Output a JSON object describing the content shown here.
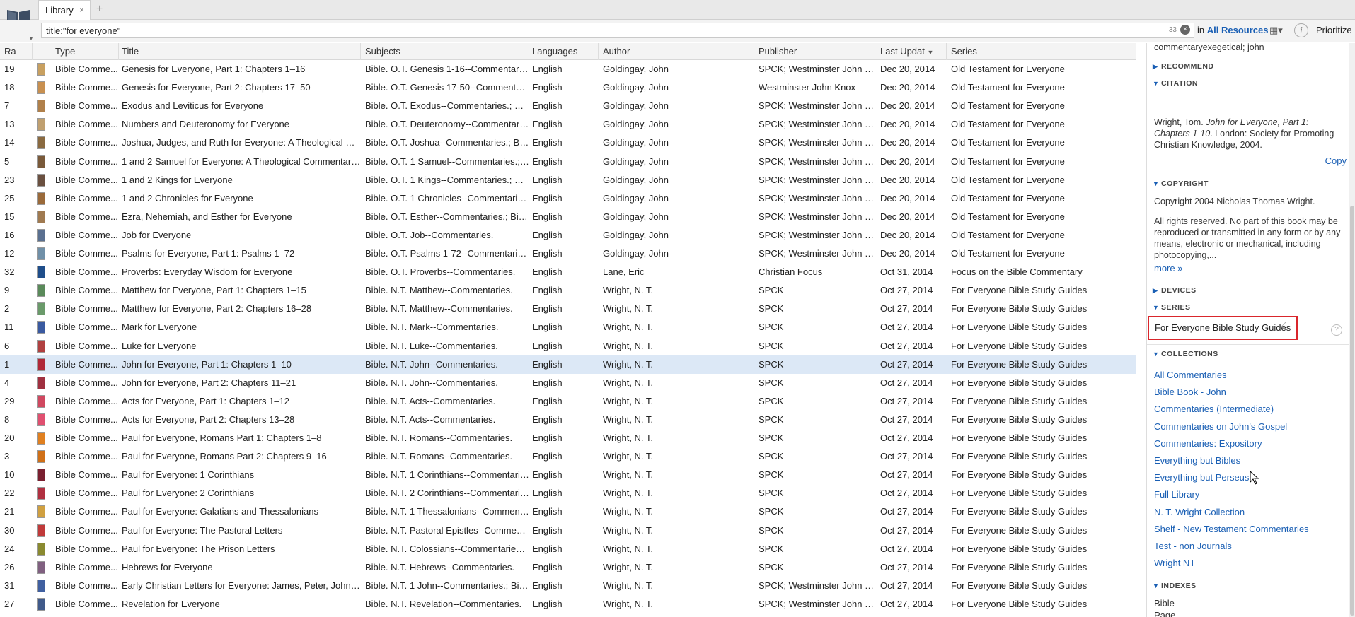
{
  "app": {
    "tab_label": "Library",
    "tab_close": "×",
    "new_tab": "+"
  },
  "search": {
    "query": "title:\"for everyone\"",
    "count": "33",
    "clear": "×",
    "in_label": "in",
    "resources": "All Resources",
    "prioritize": "Prioritize",
    "info": "i"
  },
  "columns": [
    "Ra",
    "Type",
    "Title",
    "Subjects",
    "Languages",
    "Author",
    "Publisher",
    "Last Updat",
    "Series"
  ],
  "rows": [
    {
      "rank": "19",
      "type": "Bible Comme...",
      "title": "Genesis for Everyone, Part 1: Chapters 1–16",
      "subjects": "Bible. O.T. Genesis 1-16--Commentaries.",
      "lang": "English",
      "author": "Goldingay, John",
      "publisher": "SPCK; Westminster John Knox",
      "date": "Dec 20, 2014",
      "series": "Old Testament for Everyone",
      "cover": "#c8a060"
    },
    {
      "rank": "18",
      "type": "Bible Comme...",
      "title": "Genesis for Everyone, Part 2: Chapters 17–50",
      "subjects": "Bible. O.T. Genesis 17-50--Commentaries.",
      "lang": "English",
      "author": "Goldingay, John",
      "publisher": "Westminster John Knox",
      "date": "Dec 20, 2014",
      "series": "Old Testament for Everyone",
      "cover": "#c89050"
    },
    {
      "rank": "7",
      "type": "Bible Comme...",
      "title": "Exodus and Leviticus for Everyone",
      "subjects": "Bible. O.T. Exodus--Commentaries.; Bibl...",
      "lang": "English",
      "author": "Goldingay, John",
      "publisher": "SPCK; Westminster John Knox",
      "date": "Dec 20, 2014",
      "series": "Old Testament for Everyone",
      "cover": "#b0804a"
    },
    {
      "rank": "13",
      "type": "Bible Comme...",
      "title": "Numbers and Deuteronomy for Everyone",
      "subjects": "Bible. O.T. Deuteronomy--Commentaries...",
      "lang": "English",
      "author": "Goldingay, John",
      "publisher": "SPCK; Westminster John Knox",
      "date": "Dec 20, 2014",
      "series": "Old Testament for Everyone",
      "cover": "#c0a070"
    },
    {
      "rank": "14",
      "type": "Bible Comme...",
      "title": "Joshua, Judges, and Ruth for Everyone: A Theological Com...",
      "subjects": "Bible. O.T. Joshua--Commentaries.; Bibl...",
      "lang": "English",
      "author": "Goldingay, John",
      "publisher": "SPCK; Westminster John Knox",
      "date": "Dec 20, 2014",
      "series": "Old Testament for Everyone",
      "cover": "#8a6a40"
    },
    {
      "rank": "5",
      "type": "Bible Comme...",
      "title": "1 and 2 Samuel for Everyone: A Theological Commentary on...",
      "subjects": "Bible. O.T. 1 Samuel--Commentaries.; Bi...",
      "lang": "English",
      "author": "Goldingay, John",
      "publisher": "SPCK; Westminster John Knox",
      "date": "Dec 20, 2014",
      "series": "Old Testament for Everyone",
      "cover": "#7a5a3a"
    },
    {
      "rank": "23",
      "type": "Bible Comme...",
      "title": "1 and 2 Kings for Everyone",
      "subjects": "Bible. O.T. 1 Kings--Commentaries.; Bibl...",
      "lang": "English",
      "author": "Goldingay, John",
      "publisher": "SPCK; Westminster John Knox",
      "date": "Dec 20, 2014",
      "series": "Old Testament for Everyone",
      "cover": "#6a5040"
    },
    {
      "rank": "25",
      "type": "Bible Comme...",
      "title": "1 and 2 Chronicles for Everyone",
      "subjects": "Bible. O.T. 1 Chronicles--Commentaries.;...",
      "lang": "English",
      "author": "Goldingay, John",
      "publisher": "SPCK; Westminster John Knox",
      "date": "Dec 20, 2014",
      "series": "Old Testament for Everyone",
      "cover": "#9a6a3a"
    },
    {
      "rank": "15",
      "type": "Bible Comme...",
      "title": "Ezra, Nehemiah, and Esther for Everyone",
      "subjects": "Bible. O.T. Esther--Commentaries.; Bible....",
      "lang": "English",
      "author": "Goldingay, John",
      "publisher": "SPCK; Westminster John Knox",
      "date": "Dec 20, 2014",
      "series": "Old Testament for Everyone",
      "cover": "#a07a50"
    },
    {
      "rank": "16",
      "type": "Bible Comme...",
      "title": "Job for Everyone",
      "subjects": "Bible. O.T. Job--Commentaries.",
      "lang": "English",
      "author": "Goldingay, John",
      "publisher": "SPCK; Westminster John Knox",
      "date": "Dec 20, 2014",
      "series": "Old Testament for Everyone",
      "cover": "#5a7090"
    },
    {
      "rank": "12",
      "type": "Bible Comme...",
      "title": "Psalms for Everyone, Part 1: Psalms 1–72",
      "subjects": "Bible. O.T. Psalms 1-72--Commentaries.",
      "lang": "English",
      "author": "Goldingay, John",
      "publisher": "SPCK; Westminster John Knox",
      "date": "Dec 20, 2014",
      "series": "Old Testament for Everyone",
      "cover": "#7090a8"
    },
    {
      "rank": "32",
      "type": "Bible Comme...",
      "title": "Proverbs: Everyday Wisdom for Everyone",
      "subjects": "Bible. O.T. Proverbs--Commentaries.",
      "lang": "English",
      "author": "Lane, Eric",
      "publisher": "Christian Focus",
      "date": "Oct 31, 2014",
      "series": "Focus on the Bible Commentary",
      "cover": "#1f4e8a"
    },
    {
      "rank": "9",
      "type": "Bible Comme...",
      "title": "Matthew for Everyone, Part 1: Chapters 1–15",
      "subjects": "Bible. N.T. Matthew--Commentaries.",
      "lang": "English",
      "author": "Wright, N. T.",
      "publisher": "SPCK",
      "date": "Oct 27, 2014",
      "series": "For Everyone Bible Study Guides",
      "cover": "#5a8a5a"
    },
    {
      "rank": "2",
      "type": "Bible Comme...",
      "title": "Matthew for Everyone, Part 2: Chapters 16–28",
      "subjects": "Bible. N.T. Matthew--Commentaries.",
      "lang": "English",
      "author": "Wright, N. T.",
      "publisher": "SPCK",
      "date": "Oct 27, 2014",
      "series": "For Everyone Bible Study Guides",
      "cover": "#6a9a6a"
    },
    {
      "rank": "11",
      "type": "Bible Comme...",
      "title": "Mark for Everyone",
      "subjects": "Bible. N.T. Mark--Commentaries.",
      "lang": "English",
      "author": "Wright, N. T.",
      "publisher": "SPCK",
      "date": "Oct 27, 2014",
      "series": "For Everyone Bible Study Guides",
      "cover": "#3a5aa0"
    },
    {
      "rank": "6",
      "type": "Bible Comme...",
      "title": "Luke for Everyone",
      "subjects": "Bible. N.T. Luke--Commentaries.",
      "lang": "English",
      "author": "Wright, N. T.",
      "publisher": "SPCK",
      "date": "Oct 27, 2014",
      "series": "For Everyone Bible Study Guides",
      "cover": "#b04040"
    },
    {
      "rank": "1",
      "type": "Bible Comme...",
      "title": "John for Everyone, Part 1: Chapters 1–10",
      "subjects": "Bible. N.T. John--Commentaries.",
      "lang": "English",
      "author": "Wright, N. T.",
      "publisher": "SPCK",
      "date": "Oct 27, 2014",
      "series": "For Everyone Bible Study Guides",
      "cover": "#b02838",
      "selected": true
    },
    {
      "rank": "4",
      "type": "Bible Comme...",
      "title": "John for Everyone, Part 2: Chapters 11–21",
      "subjects": "Bible. N.T. John--Commentaries.",
      "lang": "English",
      "author": "Wright, N. T.",
      "publisher": "SPCK",
      "date": "Oct 27, 2014",
      "series": "For Everyone Bible Study Guides",
      "cover": "#a03040"
    },
    {
      "rank": "29",
      "type": "Bible Comme...",
      "title": "Acts for Everyone, Part 1: Chapters 1–12",
      "subjects": "Bible. N.T. Acts--Commentaries.",
      "lang": "English",
      "author": "Wright, N. T.",
      "publisher": "SPCK",
      "date": "Oct 27, 2014",
      "series": "For Everyone Bible Study Guides",
      "cover": "#d04860"
    },
    {
      "rank": "8",
      "type": "Bible Comme...",
      "title": "Acts for Everyone, Part 2: Chapters 13–28",
      "subjects": "Bible. N.T. Acts--Commentaries.",
      "lang": "English",
      "author": "Wright, N. T.",
      "publisher": "SPCK",
      "date": "Oct 27, 2014",
      "series": "For Everyone Bible Study Guides",
      "cover": "#e05070"
    },
    {
      "rank": "20",
      "type": "Bible Comme...",
      "title": "Paul for Everyone, Romans Part 1: Chapters 1–8",
      "subjects": "Bible. N.T. Romans--Commentaries.",
      "lang": "English",
      "author": "Wright, N. T.",
      "publisher": "SPCK",
      "date": "Oct 27, 2014",
      "series": "For Everyone Bible Study Guides",
      "cover": "#e08020"
    },
    {
      "rank": "3",
      "type": "Bible Comme...",
      "title": "Paul for Everyone, Romans Part 2: Chapters 9–16",
      "subjects": "Bible. N.T. Romans--Commentaries.",
      "lang": "English",
      "author": "Wright, N. T.",
      "publisher": "SPCK",
      "date": "Oct 27, 2014",
      "series": "For Everyone Bible Study Guides",
      "cover": "#d07018"
    },
    {
      "rank": "10",
      "type": "Bible Comme...",
      "title": "Paul for Everyone: 1 Corinthians",
      "subjects": "Bible. N.T. 1 Corinthians--Commentaries.",
      "lang": "English",
      "author": "Wright, N. T.",
      "publisher": "SPCK",
      "date": "Oct 27, 2014",
      "series": "For Everyone Bible Study Guides",
      "cover": "#7a2030"
    },
    {
      "rank": "22",
      "type": "Bible Comme...",
      "title": "Paul for Everyone: 2 Corinthians",
      "subjects": "Bible. N.T. 2 Corinthians--Commentaries.",
      "lang": "English",
      "author": "Wright, N. T.",
      "publisher": "SPCK",
      "date": "Oct 27, 2014",
      "series": "For Everyone Bible Study Guides",
      "cover": "#b03040"
    },
    {
      "rank": "21",
      "type": "Bible Comme...",
      "title": "Paul for Everyone: Galatians and Thessalonians",
      "subjects": "Bible. N.T. 1 Thessalonians--Commentari...",
      "lang": "English",
      "author": "Wright, N. T.",
      "publisher": "SPCK",
      "date": "Oct 27, 2014",
      "series": "For Everyone Bible Study Guides",
      "cover": "#d0a040"
    },
    {
      "rank": "30",
      "type": "Bible Comme...",
      "title": "Paul for Everyone: The Pastoral Letters",
      "subjects": "Bible. N.T. Pastoral Epistles--Commentar...",
      "lang": "English",
      "author": "Wright, N. T.",
      "publisher": "SPCK",
      "date": "Oct 27, 2014",
      "series": "For Everyone Bible Study Guides",
      "cover": "#c03a3a"
    },
    {
      "rank": "24",
      "type": "Bible Comme...",
      "title": "Paul for Everyone: The Prison Letters",
      "subjects": "Bible. N.T. Colossians--Commentaries.; B...",
      "lang": "English",
      "author": "Wright, N. T.",
      "publisher": "SPCK",
      "date": "Oct 27, 2014",
      "series": "For Everyone Bible Study Guides",
      "cover": "#8a8a30"
    },
    {
      "rank": "26",
      "type": "Bible Comme...",
      "title": "Hebrews for Everyone",
      "subjects": "Bible. N.T. Hebrews--Commentaries.",
      "lang": "English",
      "author": "Wright, N. T.",
      "publisher": "SPCK",
      "date": "Oct 27, 2014",
      "series": "For Everyone Bible Study Guides",
      "cover": "#806080"
    },
    {
      "rank": "31",
      "type": "Bible Comme...",
      "title": "Early Christian Letters for Everyone: James, Peter, John and...",
      "subjects": "Bible. N.T. 1 John--Commentaries.; Bible...",
      "lang": "English",
      "author": "Wright, N. T.",
      "publisher": "SPCK; Westminster John Knox",
      "date": "Oct 27, 2014",
      "series": "For Everyone Bible Study Guides",
      "cover": "#4060a0"
    },
    {
      "rank": "27",
      "type": "Bible Comme...",
      "title": "Revelation for Everyone",
      "subjects": "Bible. N.T. Revelation--Commentaries.",
      "lang": "English",
      "author": "Wright, N. T.",
      "publisher": "SPCK; Westminster John Knox",
      "date": "Oct 27, 2014",
      "series": "For Everyone Bible Study Guides",
      "cover": "#405a8a"
    }
  ],
  "panel": {
    "top_text": "commentaryexegetical; john",
    "sections": {
      "recommend": "RECOMMEND",
      "citation": "CITATION",
      "copyright": "COPYRIGHT",
      "devices": "DEVICES",
      "series": "SERIES",
      "collections": "COLLECTIONS",
      "indexes": "INDEXES"
    },
    "citation_pre": "Wright, Tom. ",
    "citation_italic": "John for Everyone, Part 1: Chapters 1-10",
    "citation_post": ". London: Society for Promoting Christian Knowledge, 2004.",
    "copy": "Copy",
    "copyright_line": "Copyright 2004 Nicholas Thomas Wright.",
    "copyright_body": "All rights reserved. No part of this book may be reproduced or transmitted in any form or by any means, electronic or mechanical, including photocopying,...",
    "more": "more »",
    "series_value": "For Everyone Bible Study Guides",
    "help": "?",
    "collections": [
      "All Commentaries",
      "Bible Book - John",
      "Commentaries (Intermediate)",
      "Commentaries on John's Gospel",
      "Commentaries: Expository",
      "Everything but Bibles",
      "Everything but Perseus",
      "Full Library",
      "N. T. Wright Collection",
      "Shelf - New Testament Commentaries",
      "Test - non Journals",
      "Wright NT"
    ],
    "indexes": [
      "Bible",
      "Page"
    ]
  },
  "colors": {
    "accent": "#1a5fb4",
    "selected_row": "#dce8f6",
    "highlight_box": "#d9262c"
  }
}
